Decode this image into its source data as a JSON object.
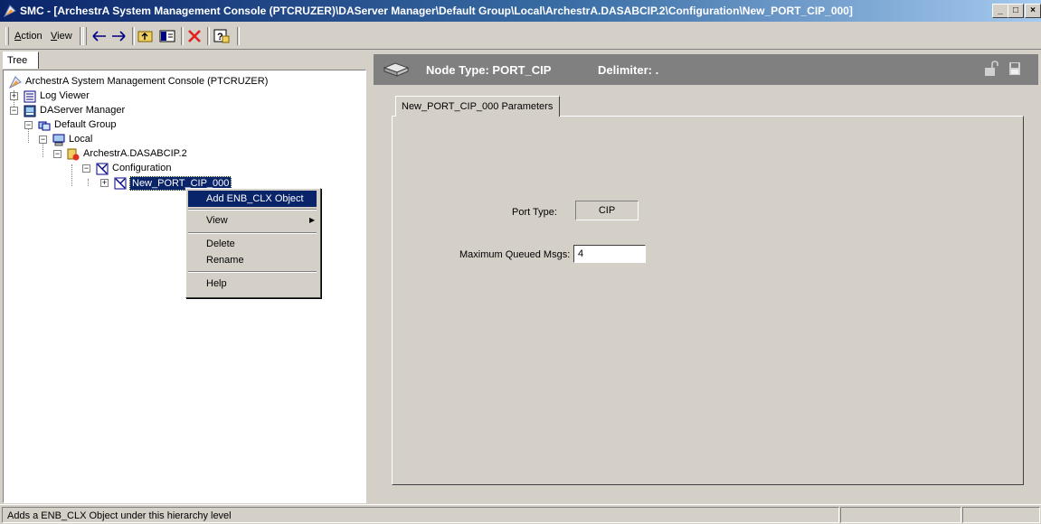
{
  "window": {
    "title": "SMC - [ArchestrA System Management Console (PTCRUZER)\\DAServer Manager\\Default Group\\Local\\ArchestrA.DASABCIP.2\\Configuration\\New_PORT_CIP_000]",
    "minimize_glyph": "_",
    "maximize_glyph": "□",
    "close_glyph": "×"
  },
  "toolbar": {
    "action_first": "A",
    "action_rest": "ction",
    "view_first": "V",
    "view_rest": "iew"
  },
  "tree": {
    "tab_label": "Tree",
    "nodes": [
      {
        "label": "ArchestrA System Management Console (PTCRUZER)",
        "icon": "smc-icon"
      },
      {
        "label": "Log Viewer",
        "icon": "log-viewer-icon"
      },
      {
        "label": "DAServer Manager",
        "icon": "daserver-icon"
      },
      {
        "label": "Default Group",
        "icon": "group-icon"
      },
      {
        "label": "Local",
        "icon": "computer-icon"
      },
      {
        "label": "ArchestrA.DASABCIP.2",
        "icon": "daserver-instance-icon"
      },
      {
        "label": "Configuration",
        "icon": "configuration-icon"
      },
      {
        "label": "New_PORT_CIP_000",
        "icon": "port-icon"
      }
    ]
  },
  "context_menu": {
    "items": [
      {
        "label": "Add ENB_CLX Object",
        "highlighted": true
      },
      {
        "label": "View",
        "submenu": true
      },
      {
        "label": "Delete"
      },
      {
        "label": "Rename"
      },
      {
        "label": "Help"
      }
    ]
  },
  "node_header": {
    "node_type": "Node Type: PORT_CIP",
    "delimiter": "Delimiter: ."
  },
  "parameters": {
    "tab_label": "New_PORT_CIP_000 Parameters",
    "port_type_label": "Port Type:",
    "port_type_value": "CIP",
    "max_queued_label": "Maximum Queued Msgs:",
    "max_queued_value": "4"
  },
  "statusbar": {
    "text": "Adds a ENB_CLX Object under this hierarchy level"
  },
  "colors": {
    "title_active": "#0a246a",
    "selection": "#0a246a",
    "face": "#d4d0c8",
    "header_gray": "#808080"
  }
}
